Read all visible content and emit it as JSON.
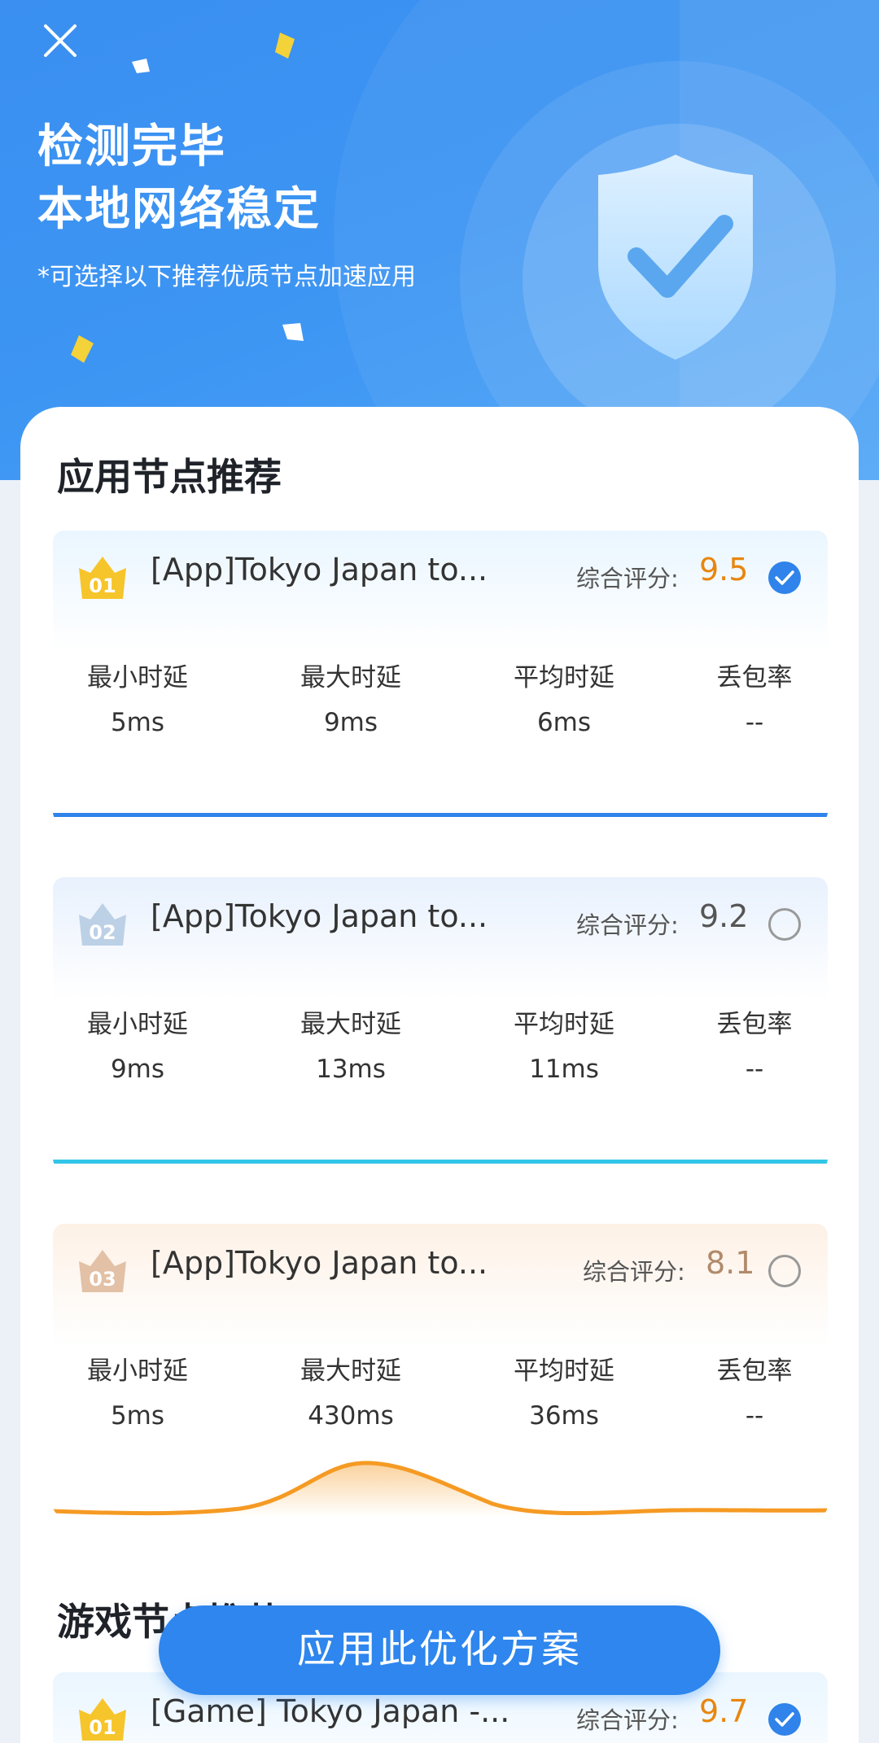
{
  "header": {
    "title_line1": "检测完毕",
    "title_line2": "本地网络稳定",
    "subtitle": "*可选择以下推荐优质节点加速应用",
    "close_icon": "close-icon",
    "shield_icon": "shield-check-icon",
    "colors": {
      "primary": "#3a8ff0",
      "accent_gold": "#f4d23a"
    }
  },
  "app_section": {
    "title": "应用节点推荐",
    "cards": [
      {
        "rank": "01",
        "name": "[App]Tokyo Japan to...",
        "score_label": "综合评分:",
        "score": "9.5",
        "score_color": "#e8860f",
        "selected": true,
        "metrics": [
          {
            "label": "最小时延",
            "value": "5ms"
          },
          {
            "label": "最大时延",
            "value": "9ms"
          },
          {
            "label": "平均时延",
            "value": "6ms"
          },
          {
            "label": "丢包率",
            "value": "--"
          }
        ],
        "line_color": "#2f83ea"
      },
      {
        "rank": "02",
        "name": "[App]Tokyo Japan to...",
        "score_label": "综合评分:",
        "score": "9.2",
        "score_color": "#555555",
        "selected": false,
        "metrics": [
          {
            "label": "最小时延",
            "value": "9ms"
          },
          {
            "label": "最大时延",
            "value": "13ms"
          },
          {
            "label": "平均时延",
            "value": "11ms"
          },
          {
            "label": "丢包率",
            "value": "--"
          }
        ],
        "line_color": "#33c6e8"
      },
      {
        "rank": "03",
        "name": "[App]Tokyo Japan to...",
        "score_label": "综合评分:",
        "score": "8.1",
        "score_color": "#b08a6a",
        "selected": false,
        "metrics": [
          {
            "label": "最小时延",
            "value": "5ms"
          },
          {
            "label": "最大时延",
            "value": "430ms"
          },
          {
            "label": "平均时延",
            "value": "36ms"
          },
          {
            "label": "丢包率",
            "value": "--"
          }
        ],
        "line_color": "#f59a23"
      }
    ]
  },
  "game_section": {
    "title": "游戏节点推荐",
    "cards": [
      {
        "rank": "01",
        "name": "[Game] Tokyo Japan -...",
        "score_label": "综合评分:",
        "score": "9.7",
        "score_color": "#e8860f",
        "selected": true
      }
    ]
  },
  "cta": {
    "label": "应用此优化方案"
  }
}
